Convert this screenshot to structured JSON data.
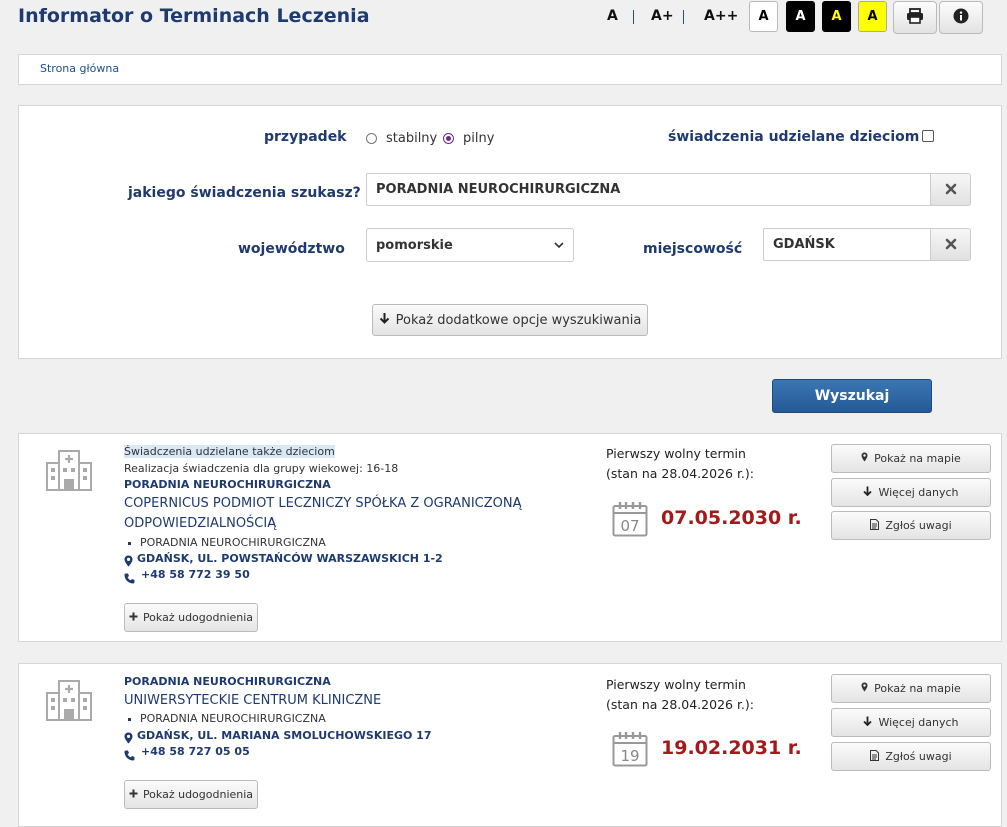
{
  "header": {
    "title": "Informator o Terminach Leczenia",
    "font_sizes": [
      "A",
      "A+",
      "A++"
    ],
    "contrast_options": [
      {
        "label": "A",
        "bg": "#ffffff",
        "fg": "#000000"
      },
      {
        "label": "A",
        "bg": "#000000",
        "fg": "#ffffff"
      },
      {
        "label": "A",
        "bg": "#000000",
        "fg": "#ffff00"
      },
      {
        "label": "A",
        "bg": "#ffff00",
        "fg": "#000000"
      }
    ],
    "print_icon": "printer-icon",
    "info_icon": "info-icon"
  },
  "breadcrumb": {
    "home": "Strona główna"
  },
  "search": {
    "case_label": "przypadek",
    "case_options": [
      "stabilny",
      "pilny"
    ],
    "case_selected": "pilny",
    "children_label": "świadczenia udzielane dzieciom",
    "children_checked": false,
    "service_label": "jakiego świadczenia szukasz?",
    "service_value": "PORADNIA NEUROCHIRURGICZNA",
    "voivodeship_label": "województwo",
    "voivodeship_value": "pomorskie",
    "city_label": "miejscowość",
    "city_value": "GDAŃSK",
    "more_options_label": "Pokaż dodatkowe opcje wyszukiwania",
    "search_button": "Wyszukaj"
  },
  "results": [
    {
      "children_note": "Świadczenia udzielane także dzieciom",
      "age_group": "Realizacja świadczenia dla grupy wiekowej: 16-18",
      "service": "PORADNIA NEUROCHIRURGICZNA",
      "provider_line1": "COPERNICUS PODMIOT LECZNICZY SPÓŁKA Z OGRANICZONĄ",
      "provider_line2": "ODPOWIEDZIALNOŚCIĄ",
      "unit": "PORADNIA NEUROCHIRURGICZNA",
      "address": "GDAŃSK, UL. POWSTAŃCÓW WARSZAWSKICH 1-2",
      "phone": "+48 58 772 39 50",
      "amenities_button": "Pokaż udogodnienia",
      "first_term_label": "Pierwszy wolny termin",
      "status_label": "(stan na 28.04.2026 r.):",
      "calendar_day": "07",
      "first_date": "07.05.2030 r.",
      "map_button": "Pokaż na mapie",
      "more_button": "Więcej danych",
      "report_button": "Zgłoś uwagi"
    },
    {
      "service": "PORADNIA NEUROCHIRURGICZNA",
      "provider_line1": "UNIWERSYTECKIE CENTRUM KLINICZNE",
      "unit": "PORADNIA NEUROCHIRURGICZNA",
      "address": "GDAŃSK, UL. MARIANA SMOLUCHOWSKIEGO 17",
      "phone": "+48 58 727 05 05",
      "amenities_button": "Pokaż udogodnienia",
      "first_term_label": "Pierwszy wolny termin",
      "status_label": "(stan na 28.04.2026 r.):",
      "calendar_day": "19",
      "first_date": "19.02.2031 r.",
      "map_button": "Pokaż na mapie",
      "more_button": "Więcej danych",
      "report_button": "Zgłoś uwagi"
    }
  ]
}
